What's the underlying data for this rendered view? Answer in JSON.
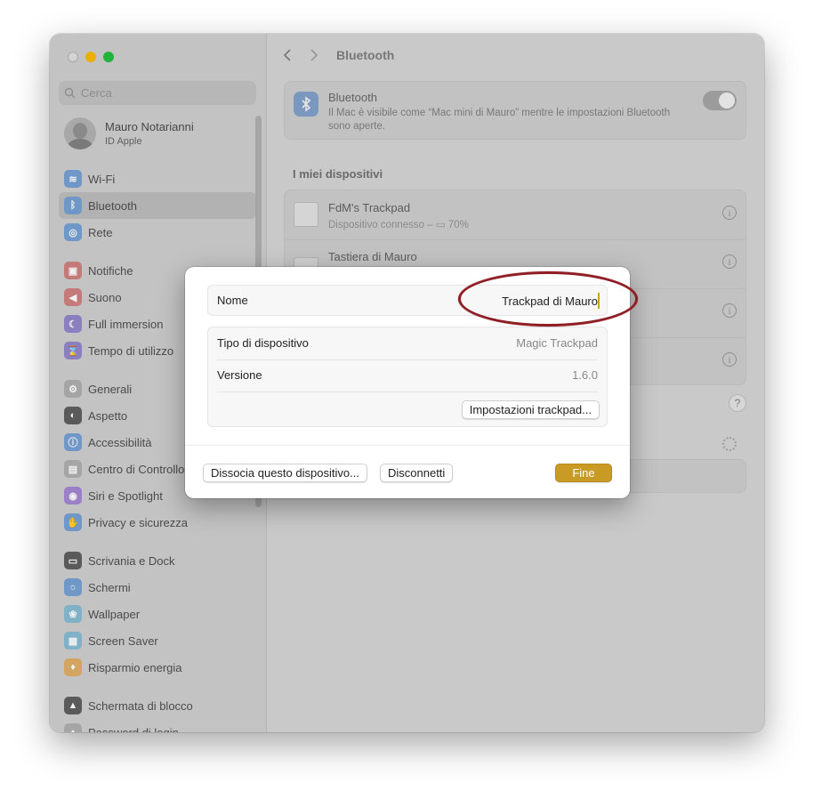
{
  "window": {
    "search_placeholder": "Cerca",
    "user": {
      "name": "Mauro Notarianni",
      "subtitle": "ID Apple"
    },
    "sidebar": [
      {
        "label": "Wi-Fi",
        "color": "#6f97c7",
        "glyph": "≋"
      },
      {
        "label": "Bluetooth",
        "color": "#6f97c7",
        "glyph": "ᛒ"
      },
      {
        "label": "Rete",
        "color": "#6f97c7",
        "glyph": "◎"
      },
      {
        "label": "Notifiche",
        "color": "#c57a7a",
        "glyph": "▣"
      },
      {
        "label": "Suono",
        "color": "#c57a7a",
        "glyph": "◀"
      },
      {
        "label": "Full immersion",
        "color": "#8b7fbf",
        "glyph": "☾"
      },
      {
        "label": "Tempo di utilizzo",
        "color": "#8b7fbf",
        "glyph": "⌛"
      },
      {
        "label": "Generali",
        "color": "#a5a5a5",
        "glyph": "⚙"
      },
      {
        "label": "Aspetto",
        "color": "#5a5a5a",
        "glyph": "◐"
      },
      {
        "label": "Accessibilità",
        "color": "#6f97c7",
        "glyph": "ⓘ"
      },
      {
        "label": "Centro di Controllo",
        "color": "#a5a5a5",
        "glyph": "▤"
      },
      {
        "label": "Siri e Spotlight",
        "color": "#9b7fc7",
        "glyph": "◉"
      },
      {
        "label": "Privacy e sicurezza",
        "color": "#6f97c7",
        "glyph": "✋"
      },
      {
        "label": "Scrivania e Dock",
        "color": "#5a5a5a",
        "glyph": "▭"
      },
      {
        "label": "Schermi",
        "color": "#6f97c7",
        "glyph": "☼"
      },
      {
        "label": "Wallpaper",
        "color": "#7fb2c7",
        "glyph": "❀"
      },
      {
        "label": "Screen Saver",
        "color": "#7fb2c7",
        "glyph": "▦"
      },
      {
        "label": "Risparmio energia",
        "color": "#d3a560",
        "glyph": "♦"
      },
      {
        "label": "Schermata di blocco",
        "color": "#5a5a5a",
        "glyph": "▲"
      },
      {
        "label": "Password di login",
        "color": "#a5a5a5",
        "glyph": "•"
      }
    ],
    "page_title": "Bluetooth",
    "bluetooth": {
      "title": "Bluetooth",
      "description": "Il Mac è visibile come “Mac mini di Mauro” mentre le impostazioni Bluetooth sono aperte.",
      "enabled": true
    },
    "devices_title": "I miei dispositivi",
    "devices": [
      {
        "name": "FdM's Trackpad",
        "status": "Dispositivo connesso –  ▭ 70%"
      },
      {
        "name": "Tastiera di Mauro",
        "status": ""
      }
    ]
  },
  "dialog": {
    "name_label": "Nome",
    "name_value": "Trackpad di Mauro",
    "rows": [
      {
        "label": "Tipo di dispositivo",
        "value": "Magic Trackpad"
      },
      {
        "label": "Versione",
        "value": "1.6.0"
      }
    ],
    "trackpad_settings_button": "Impostazioni trackpad...",
    "dissocia_button": "Dissocia questo dispositivo...",
    "disconnect_button": "Disconnetti",
    "done_button": "Fine",
    "accent_color": "#c99b24",
    "annotation_color": "#8e1d24"
  }
}
